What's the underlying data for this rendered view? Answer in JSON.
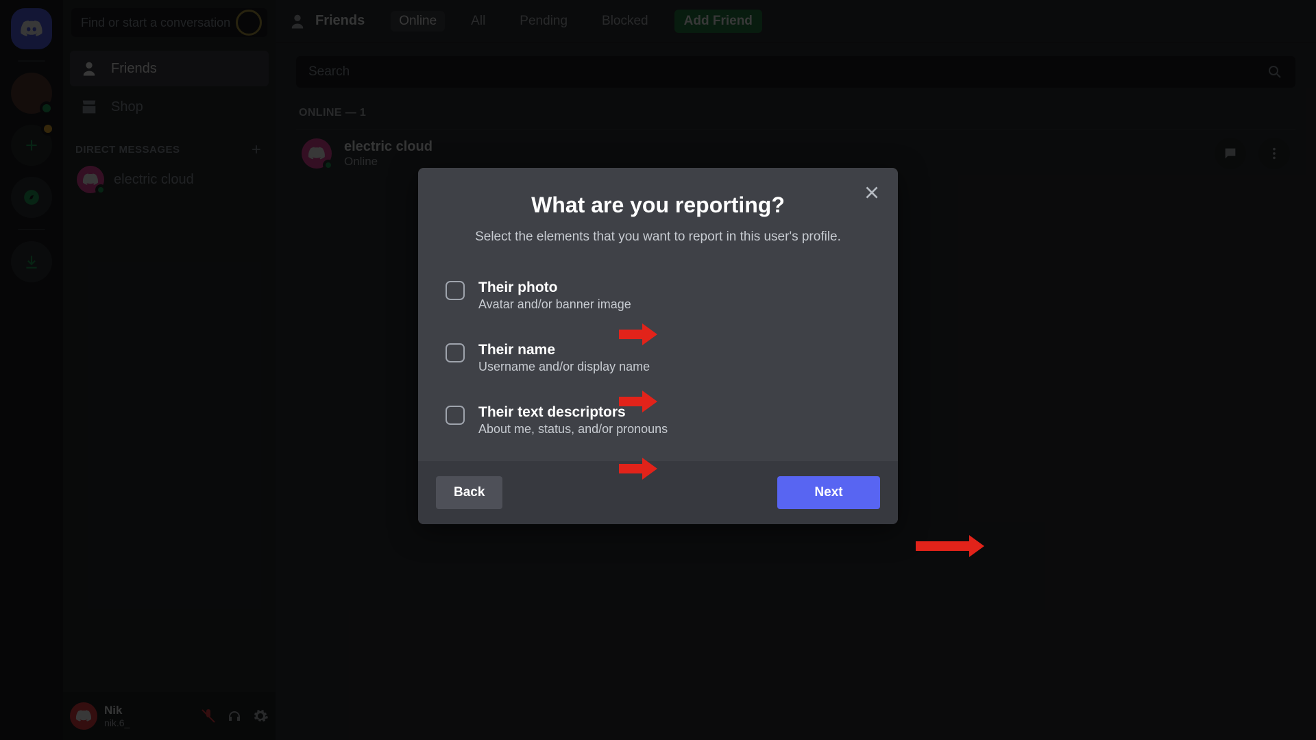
{
  "sidebar": {
    "search_placeholder": "Find or start a conversation",
    "friends_label": "Friends",
    "shop_label": "Shop",
    "dm_header": "DIRECT MESSAGES",
    "dms": [
      {
        "name": "electric cloud"
      }
    ]
  },
  "user_panel": {
    "name": "Nik",
    "tag": "nik.6_"
  },
  "toolbar": {
    "title": "Friends",
    "tabs": {
      "online": "Online",
      "all": "All",
      "pending": "Pending",
      "blocked": "Blocked"
    },
    "add_friend": "Add Friend"
  },
  "content": {
    "search_placeholder": "Search",
    "online_header": "ONLINE — 1",
    "friends": [
      {
        "name": "electric cloud",
        "status": "Online"
      }
    ]
  },
  "modal": {
    "title": "What are you reporting?",
    "subtitle": "Select the elements that you want to report in this user's profile.",
    "options": [
      {
        "title": "Their photo",
        "desc": "Avatar and/or banner image"
      },
      {
        "title": "Their name",
        "desc": "Username and/or display name"
      },
      {
        "title": "Their text descriptors",
        "desc": "About me, status, and/or pronouns"
      }
    ],
    "back": "Back",
    "next": "Next"
  }
}
